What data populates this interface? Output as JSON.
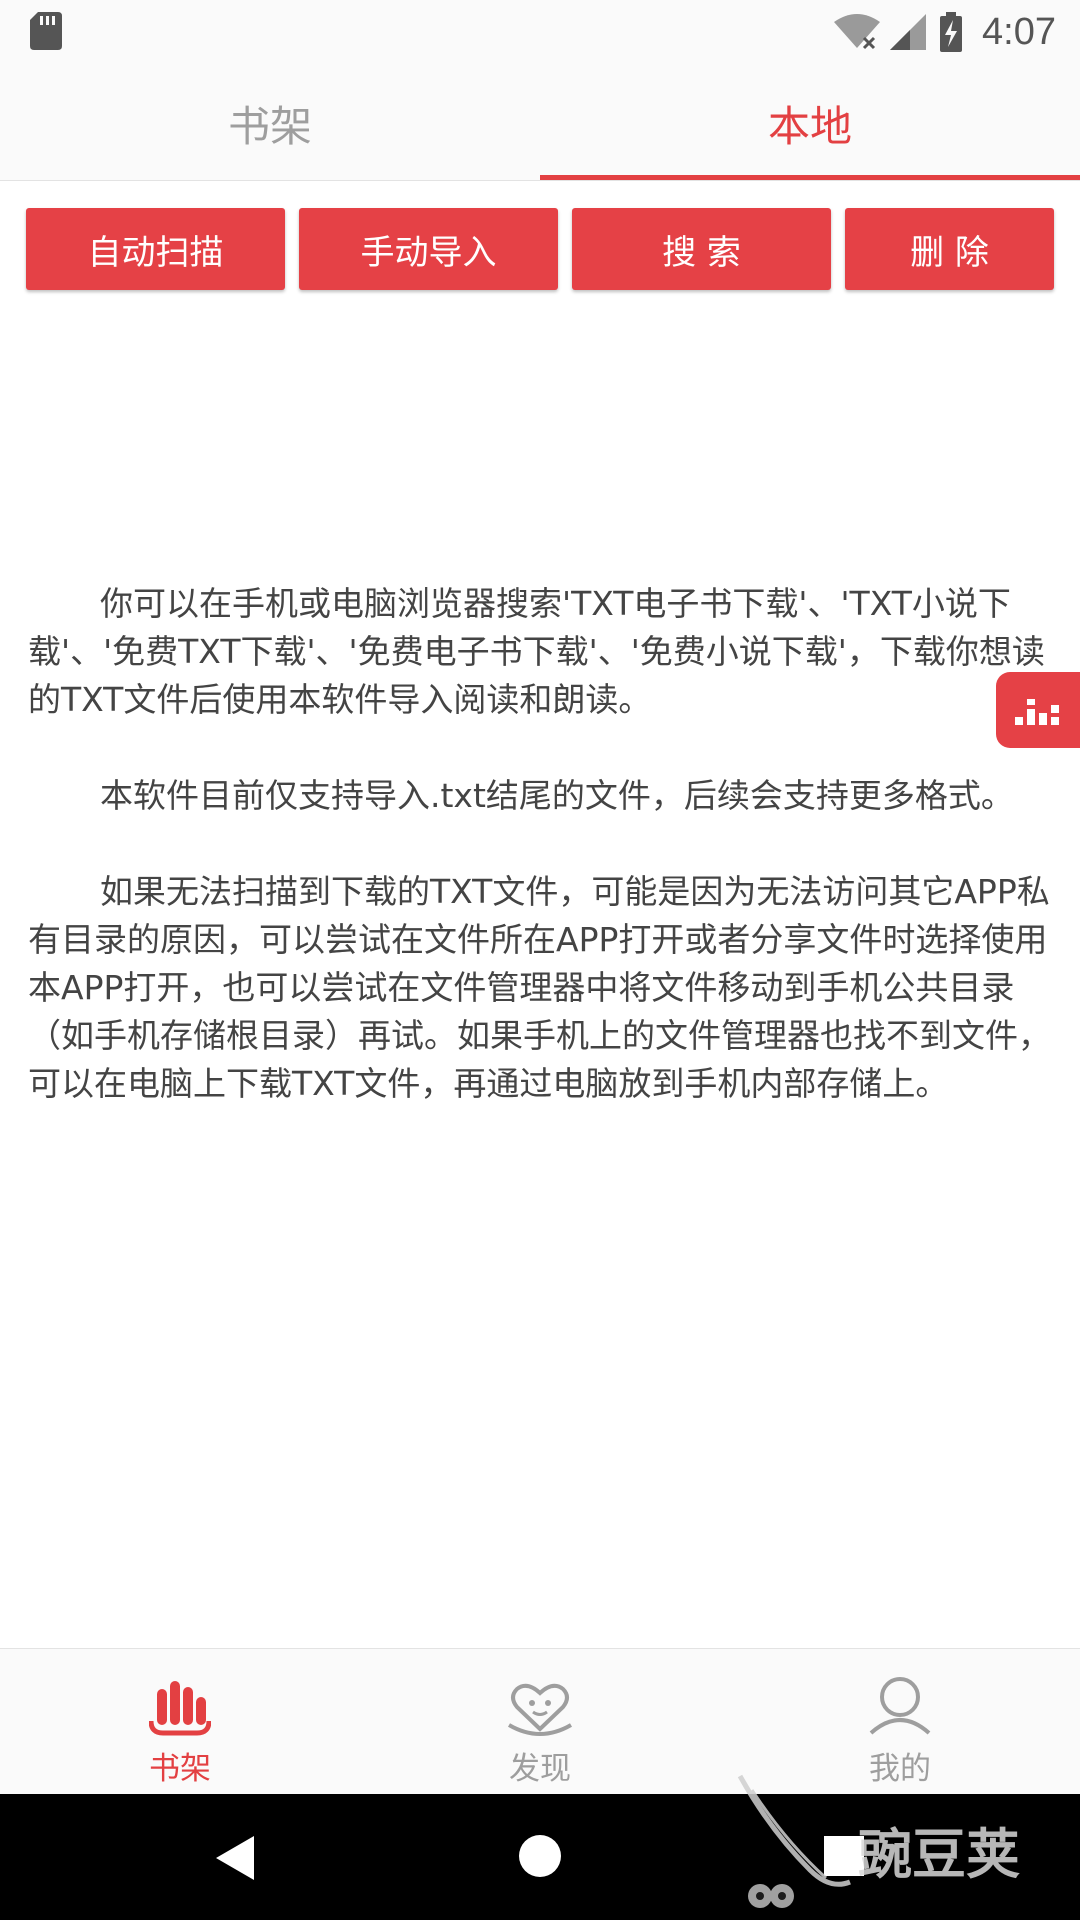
{
  "status_bar": {
    "time": "4:07",
    "icons": [
      "sd-card-icon",
      "wifi-icon",
      "signal-icon",
      "battery-charging-icon"
    ]
  },
  "tabs": [
    {
      "label": "书架",
      "selected": false
    },
    {
      "label": "本地",
      "selected": true
    }
  ],
  "actions": [
    {
      "label": "自动扫描"
    },
    {
      "label": "手动导入"
    },
    {
      "label": "搜 索"
    },
    {
      "label": "删 除"
    }
  ],
  "content": {
    "paragraphs": [
      "你可以在手机或电脑浏览器搜索'TXT电子书下载'、'TXT小说下载'、'免费TXT下载'、'免费电子书下载'、'免费小说下载'，下载你想读的TXT文件后使用本软件导入阅读和朗读。",
      "本软件目前仅支持导入.txt结尾的文件，后续会支持更多格式。",
      "如果无法扫描到下载的TXT文件，可能是因为无法访问其它APP私有目录的原因，可以尝试在文件所在APP打开或者分享文件时选择使用本APP打开，也可以尝试在文件管理器中将文件移动到手机公共目录（如手机存储根目录）再试。如果手机上的文件管理器也找不到文件，可以在电脑上下载TXT文件，再通过电脑放到手机内部存储上。"
    ]
  },
  "float_button": {
    "icon": "equalizer-icon"
  },
  "bottom_nav": [
    {
      "label": "书架",
      "icon": "bookshelf-icon",
      "active": true
    },
    {
      "label": "发现",
      "icon": "discover-heart-icon",
      "active": false
    },
    {
      "label": "我的",
      "icon": "profile-icon",
      "active": false
    }
  ],
  "system_nav": {
    "icons": [
      "back-icon",
      "home-icon",
      "recents-icon"
    ]
  },
  "watermark": {
    "text": "豌豆荚"
  },
  "colors": {
    "accent": "#e54146",
    "tab_active": "#e34042",
    "text": "#444444",
    "inactive": "#9e9e9e"
  }
}
